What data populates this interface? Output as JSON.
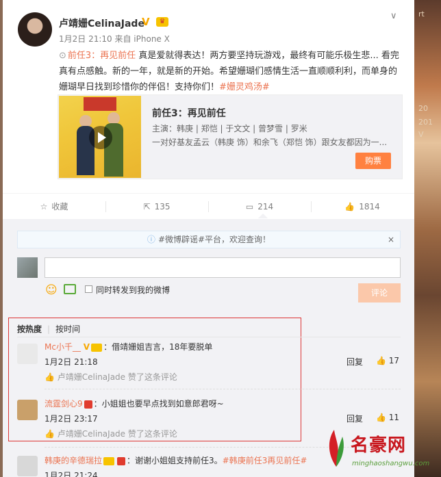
{
  "background_text": [
    "rt",
    "20",
    "201",
    "V"
  ],
  "post": {
    "author": "卢靖姗CelinaJade",
    "meta": "1月2日 21:10 来自 iPhone X",
    "movie_link": "前任3：再见前任",
    "text": " 真是爱就得表达！两方要坚持玩游戏，最终有可能乐极生悲... 看完真有点感触。新的一年，就是新的开始。希望姗瑚们感情生活一直顺顺利利，而单身的姗瑚早日找到珍惜你的伴侣！支持你们！",
    "hashtag": "#姗灵鸡汤#"
  },
  "movie_card": {
    "title": "前任3：再见前任",
    "cast": "主演：韩庚 | 郑恺 | 于文文 | 曾梦雪 | 罗米",
    "desc": "一对好基友孟云（韩庚 饰）和余飞（郑恺 饰）跟女友都因为一...",
    "buy_label": "购票"
  },
  "actions": {
    "favorite": "收藏",
    "repost_count": "135",
    "comment_count": "214",
    "like_count": "1814"
  },
  "notice": "#微博辟谣#平台，欢迎查询！",
  "compose": {
    "repost_label": "同时转发到我的微博",
    "submit_label": "评论"
  },
  "sort": {
    "hot": "按热度",
    "time": "按时间"
  },
  "comments": [
    {
      "name": "Mc小千__",
      "text": "：借靖姗姐吉言，18年要脱单",
      "time": "1月2日 21:18",
      "liked_by": "卢靖姗CelinaJade 赞了这条评论",
      "reply": "回复",
      "likes": "17"
    },
    {
      "name": "流霆剑心9",
      "text": "：小姐姐也要早点找到如意郎君呀~",
      "time": "1月2日 23:17",
      "liked_by": "卢靖姗CelinaJade 赞了这条评论",
      "reply": "回复",
      "likes": "11"
    },
    {
      "name": "韩庚的辛德瑞拉",
      "text": "：谢谢小姐姐支持前任3。",
      "hashtag": "#韩庚前任3再见前任#",
      "time": "1月2日 21:24"
    }
  ],
  "watermark": {
    "text": "名豪网",
    "url": "minghaoshangwu.com"
  }
}
